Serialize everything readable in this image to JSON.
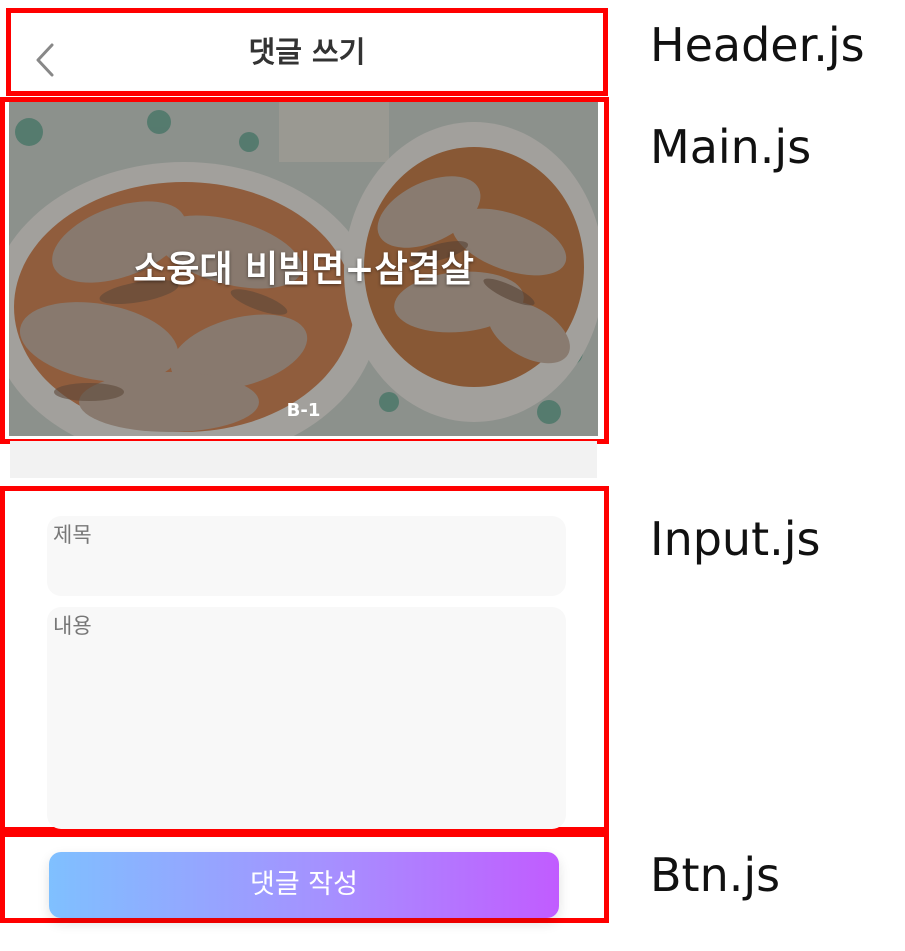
{
  "header": {
    "title": "댓글 쓰기",
    "back_icon": "chevron-left-icon"
  },
  "main": {
    "title": "소융대 비빔면+삼겹살",
    "code": "B-1"
  },
  "form": {
    "title_label": "제목",
    "content_label": "내용"
  },
  "button": {
    "label": "댓글 작성"
  },
  "annotations": {
    "header": "Header.js",
    "main": "Main.js",
    "input": "Input.js",
    "btn": "Btn.js"
  },
  "colors": {
    "frame": "#ff0000",
    "button_gradient_start": "#7fc0ff",
    "button_gradient_end": "#c15cff",
    "field_bg": "#f8f8f8"
  }
}
